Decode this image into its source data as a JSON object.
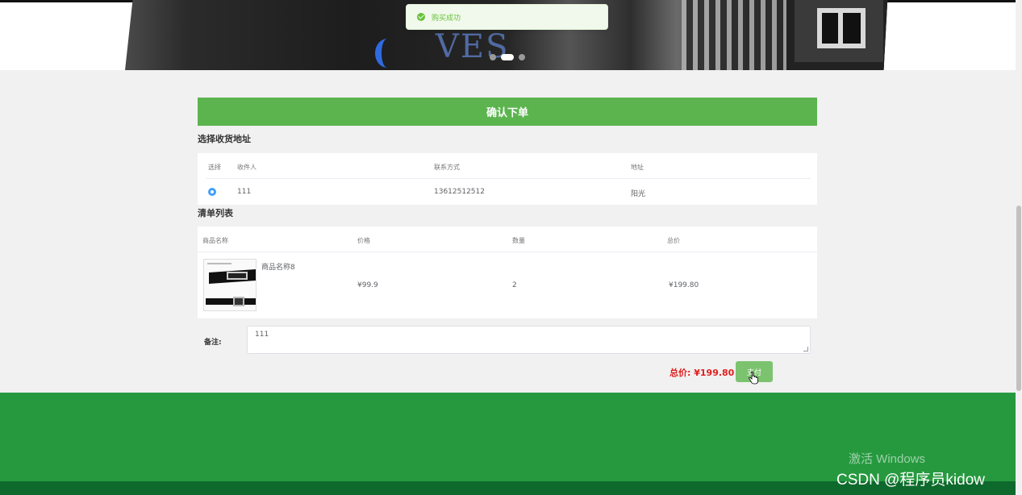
{
  "toast": {
    "icon": "check-circle-icon",
    "message": "购买成功"
  },
  "banner": {
    "brand_text": "VES",
    "carousel_dots": 3,
    "active_dot": 2
  },
  "order": {
    "header": "确认下单",
    "address_section_title": "选择收货地址",
    "address_table": {
      "columns": [
        "选择",
        "收件人",
        "联系方式",
        "地址"
      ],
      "rows": [
        {
          "selected": true,
          "recipient": "111",
          "phone": "13612512512",
          "address": "阳光"
        }
      ]
    },
    "items_section_title": "清单列表",
    "items_table": {
      "columns": [
        "商品名称",
        "价格",
        "数量",
        "总价"
      ],
      "rows": [
        {
          "name": "商品名称8",
          "price": "¥99.9",
          "quantity": "2",
          "total": "¥199.80"
        }
      ]
    },
    "remark_label": "备注:",
    "remark_value": "111",
    "total_label": "总价: ¥199.80",
    "pay_button": "支付"
  },
  "colors": {
    "header_green": "#5cb44f",
    "footer_green": "#26993f",
    "footer_dark": "#0e6a2c",
    "total_red": "#e0201f",
    "radio_blue": "#409eff"
  },
  "watermark": {
    "activate": "激活 Windows",
    "csdn": "CSDN @程序员kidow"
  }
}
